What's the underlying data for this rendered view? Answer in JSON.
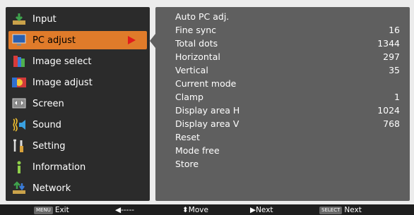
{
  "sidebar": {
    "items": [
      {
        "label": "Input",
        "icon": "input-icon",
        "active": false
      },
      {
        "label": "PC adjust",
        "icon": "pc-adjust-icon",
        "active": true
      },
      {
        "label": "Image select",
        "icon": "image-select-icon",
        "active": false
      },
      {
        "label": "Image adjust",
        "icon": "image-adjust-icon",
        "active": false
      },
      {
        "label": "Screen",
        "icon": "screen-icon",
        "active": false
      },
      {
        "label": "Sound",
        "icon": "sound-icon",
        "active": false
      },
      {
        "label": "Setting",
        "icon": "setting-icon",
        "active": false
      },
      {
        "label": "Information",
        "icon": "information-icon",
        "active": false
      },
      {
        "label": "Network",
        "icon": "network-icon",
        "active": false
      }
    ],
    "active_color": "#e07b2a"
  },
  "panel": {
    "rows": [
      {
        "label": "Auto PC adj.",
        "value": ""
      },
      {
        "label": "Fine sync",
        "value": "16"
      },
      {
        "label": "Total dots",
        "value": "1344"
      },
      {
        "label": "Horizontal",
        "value": "297"
      },
      {
        "label": "Vertical",
        "value": "35"
      },
      {
        "label": "Current mode",
        "value": ""
      },
      {
        "label": "Clamp",
        "value": "1"
      },
      {
        "label": "Display area H",
        "value": "1024"
      },
      {
        "label": "Display area V",
        "value": "768"
      },
      {
        "label": "Reset",
        "value": ""
      },
      {
        "label": "Mode free",
        "value": ""
      },
      {
        "label": "Store",
        "value": ""
      }
    ]
  },
  "footer": {
    "exit_key": "MENU",
    "exit_label": "Exit",
    "back_label": "◀-----",
    "move_label": "⬍Move",
    "next_label": "▶Next",
    "select_key": "SELECT",
    "select_next_label": "Next"
  }
}
